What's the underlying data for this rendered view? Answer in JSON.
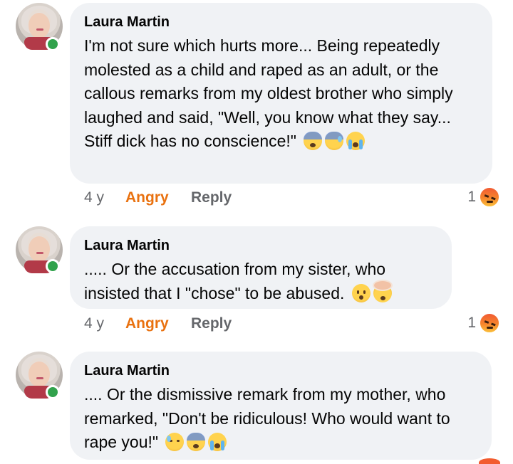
{
  "comments": [
    {
      "author": "Laura Martin",
      "text": "I'm not sure which hurts more... Being repeatedly molested as a child and raped as an adult, or the callous remarks from my oldest brother who simply laughed and said, \"Well, you know what they say... Stiff dick has no conscience!\"",
      "emojis": [
        "fearful-icon",
        "cold-sweat-icon",
        "crying-icon"
      ],
      "time": "4 y",
      "reaction_label": "Angry",
      "reply_label": "Reply",
      "reaction_count": "1",
      "reaction_icon": "angry-face-icon"
    },
    {
      "author": "Laura Martin",
      "text": "..... Or the accusation from my sister, who insisted that I \"chose\" to be abused.",
      "emojis": [
        "hushed-icon",
        "exploding-head-icon"
      ],
      "time": "4 y",
      "reaction_label": "Angry",
      "reply_label": "Reply",
      "reaction_count": "1",
      "reaction_icon": "angry-face-icon"
    },
    {
      "author": "Laura Martin",
      "text": ".... Or the dismissive remark from my mother, who remarked, \"Don't be ridiculous! Who would want to rape you!\"",
      "emojis": [
        "sad-sweat-icon",
        "fearful-icon",
        "crying-icon"
      ]
    }
  ],
  "colors": {
    "bubble": "#f0f2f5",
    "angry_text": "#e9710f",
    "meta_text": "#65676b",
    "online": "#31a24c"
  }
}
